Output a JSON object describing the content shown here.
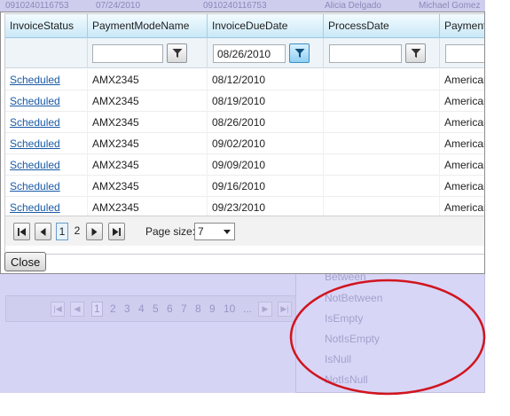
{
  "background": {
    "top_row": [
      "0910240116753",
      "07/24/2010",
      "0910240116753",
      "Alicia Delgado",
      "Michael Gomez"
    ],
    "pager": {
      "pages": [
        "1",
        "2",
        "3",
        "4",
        "5",
        "6",
        "7",
        "8",
        "9",
        "10",
        "..."
      ]
    },
    "filter_menu_options": [
      "Between",
      "NotBetween",
      "IsEmpty",
      "NotIsEmpty",
      "IsNull",
      "NotIsNull"
    ]
  },
  "grid": {
    "columns": [
      "InvoiceStatus",
      "PaymentModeName",
      "InvoiceDueDate",
      "ProcessDate",
      "PaymentMode"
    ],
    "filters": {
      "invoice_status": "",
      "payment_mode_name": "",
      "invoice_due_date": "08/26/2010",
      "process_date": "",
      "payment_mode": ""
    },
    "rows": [
      {
        "status": "Scheduled",
        "payment_mode_name": "AMX2345",
        "due_date": "08/12/2010",
        "process_date": "",
        "payment_mode": "American Express"
      },
      {
        "status": "Scheduled",
        "payment_mode_name": "AMX2345",
        "due_date": "08/19/2010",
        "process_date": "",
        "payment_mode": "American Express"
      },
      {
        "status": "Scheduled",
        "payment_mode_name": "AMX2345",
        "due_date": "08/26/2010",
        "process_date": "",
        "payment_mode": "American Express"
      },
      {
        "status": "Scheduled",
        "payment_mode_name": "AMX2345",
        "due_date": "09/02/2010",
        "process_date": "",
        "payment_mode": "American Express"
      },
      {
        "status": "Scheduled",
        "payment_mode_name": "AMX2345",
        "due_date": "09/09/2010",
        "process_date": "",
        "payment_mode": "American Express"
      },
      {
        "status": "Scheduled",
        "payment_mode_name": "AMX2345",
        "due_date": "09/16/2010",
        "process_date": "",
        "payment_mode": "American Express"
      },
      {
        "status": "Scheduled",
        "payment_mode_name": "AMX2345",
        "due_date": "09/23/2010",
        "process_date": "",
        "payment_mode": "American Express"
      }
    ],
    "pager": {
      "pages": [
        "1",
        "2"
      ],
      "current_page": "1",
      "page_size_label": "Page size:",
      "page_size_value": "7"
    }
  },
  "dialog": {
    "close_label": "Close"
  },
  "colors": {
    "overlay": "#d6d4f4",
    "header_gradient_bottom": "#c9e8f7",
    "link": "#1a5aa6",
    "annotation": "#d0151f"
  }
}
